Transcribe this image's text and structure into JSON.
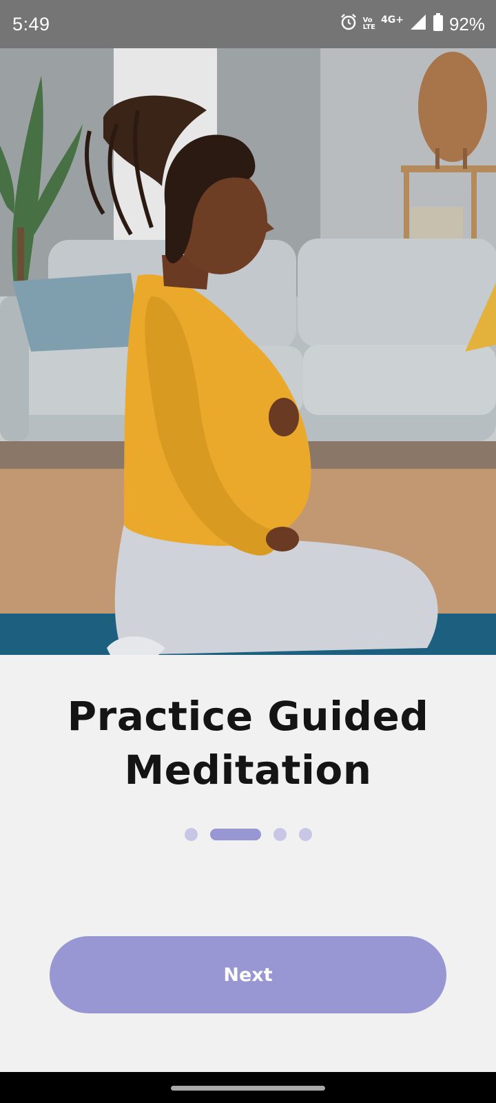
{
  "status_bar": {
    "time": "5:49",
    "volte_top": "Vo",
    "volte_bottom": "LTE",
    "network": "4G+",
    "battery": "92%",
    "icons": [
      "alarm-icon",
      "volte-icon",
      "signal-icon",
      "battery-icon"
    ]
  },
  "hero": {
    "image": "pregnant woman kneeling on yoga mat in living room"
  },
  "onboarding": {
    "title_line1": "Practice Guided",
    "title_line2": "Meditation",
    "page_indicator": {
      "total": 4,
      "current": 2
    },
    "next_label": "Next"
  },
  "colors": {
    "accent": "#9896d3",
    "dot_inactive": "#c8c6e6",
    "background": "#f1f1f1",
    "title": "#141414"
  }
}
